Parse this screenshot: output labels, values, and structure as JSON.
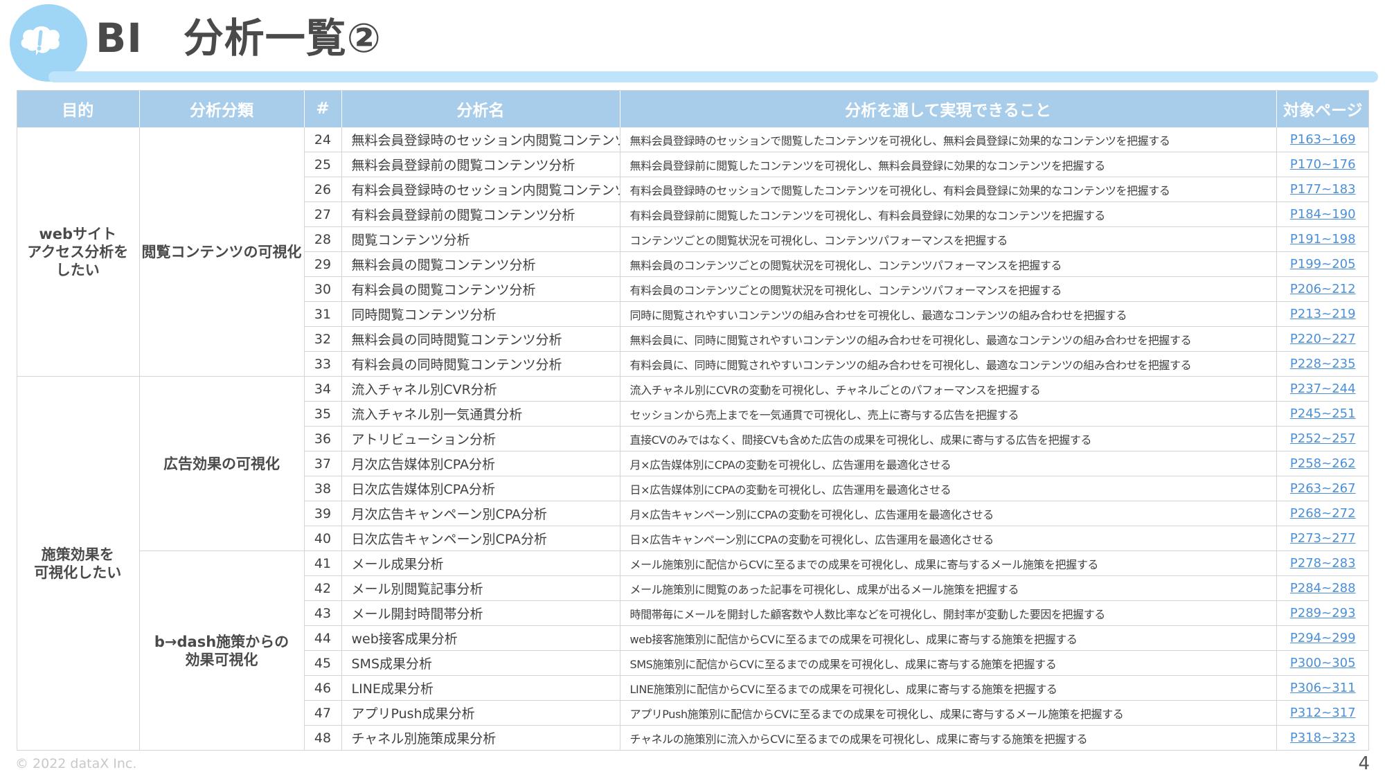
{
  "header": {
    "title": "BI　分析一覧②",
    "icon": "thought-bubble-exclamation-icon",
    "accent_color": "#9fd6f5"
  },
  "table": {
    "columns": [
      "目的",
      "分析分類",
      "#",
      "分析名",
      "分析を通して実現できること",
      "対象ページ"
    ],
    "groups": [
      {
        "purpose": "webサイト\nアクセス分析を\nしたい",
        "categories": [
          {
            "label": "閲覧コンテンツの可視化",
            "rows": [
              {
                "num": "24",
                "name": "無料会員登録時のセッション内閲覧コンテンツ分析",
                "desc": "無料会員登録時のセッションで閲覧したコンテンツを可視化し、無料会員登録に効果的なコンテンツを把握する",
                "page": "P163~169"
              },
              {
                "num": "25",
                "name": "無料会員登録前の閲覧コンテンツ分析",
                "desc": "無料会員登録前に閲覧したコンテンツを可視化し、無料会員登録に効果的なコンテンツを把握する",
                "page": "P170~176"
              },
              {
                "num": "26",
                "name": "有料会員登録時のセッション内閲覧コンテンツ分析",
                "desc": "有料会員登録時のセッションで閲覧したコンテンツを可視化し、有料会員登録に効果的なコンテンツを把握する",
                "page": "P177~183"
              },
              {
                "num": "27",
                "name": "有料会員登録前の閲覧コンテンツ分析",
                "desc": "有料会員登録前に閲覧したコンテンツを可視化し、有料会員登録に効果的なコンテンツを把握する",
                "page": "P184~190"
              },
              {
                "num": "28",
                "name": "閲覧コンテンツ分析",
                "desc": "コンテンツごとの閲覧状況を可視化し、コンテンツパフォーマンスを把握する",
                "page": "P191~198"
              },
              {
                "num": "29",
                "name": "無料会員の閲覧コンテンツ分析",
                "desc": "無料会員のコンテンツごとの閲覧状況を可視化し、コンテンツパフォーマンスを把握する",
                "page": "P199~205"
              },
              {
                "num": "30",
                "name": "有料会員の閲覧コンテンツ分析",
                "desc": "有料会員のコンテンツごとの閲覧状況を可視化し、コンテンツパフォーマンスを把握する",
                "page": "P206~212"
              },
              {
                "num": "31",
                "name": "同時閲覧コンテンツ分析",
                "desc": "同時に閲覧されやすいコンテンツの組み合わせを可視化し、最適なコンテンツの組み合わせを把握する",
                "page": "P213~219"
              },
              {
                "num": "32",
                "name": "無料会員の同時閲覧コンテンツ分析",
                "desc": "無料会員に、同時に閲覧されやすいコンテンツの組み合わせを可視化し、最適なコンテンツの組み合わせを把握する",
                "page": "P220~227"
              },
              {
                "num": "33",
                "name": "有料会員の同時閲覧コンテンツ分析",
                "desc": "有料会員に、同時に閲覧されやすいコンテンツの組み合わせを可視化し、最適なコンテンツの組み合わせを把握する",
                "page": "P228~235"
              }
            ]
          }
        ]
      },
      {
        "purpose": "施策効果を\n可視化したい",
        "categories": [
          {
            "label": "広告効果の可視化",
            "rows": [
              {
                "num": "34",
                "name": "流入チャネル別CVR分析",
                "desc": "流入チャネル別にCVRの変動を可視化し、チャネルごとのパフォーマンスを把握する",
                "page": "P237~244"
              },
              {
                "num": "35",
                "name": "流入チャネル別一気通貫分析",
                "desc": "セッションから売上までを一気通貫で可視化し、売上に寄与する広告を把握する",
                "page": "P245~251"
              },
              {
                "num": "36",
                "name": "アトリビューション分析",
                "desc": "直接CVのみではなく、間接CVも含めた広告の成果を可視化し、成果に寄与する広告を把握する",
                "page": "P252~257"
              },
              {
                "num": "37",
                "name": "月次広告媒体別CPA分析",
                "desc": "月×広告媒体別にCPAの変動を可視化し、広告運用を最適化させる",
                "page": "P258~262"
              },
              {
                "num": "38",
                "name": "日次広告媒体別CPA分析",
                "desc": "日×広告媒体別にCPAの変動を可視化し、広告運用を最適化させる",
                "page": "P263~267"
              },
              {
                "num": "39",
                "name": "月次広告キャンペーン別CPA分析",
                "desc": "月×広告キャンペーン別にCPAの変動を可視化し、広告運用を最適化させる",
                "page": "P268~272"
              },
              {
                "num": "40",
                "name": "日次広告キャンペーン別CPA分析",
                "desc": "日×広告キャンペーン別にCPAの変動を可視化し、広告運用を最適化させる",
                "page": "P273~277"
              }
            ]
          },
          {
            "label": "b→dash施策からの\n効果可視化",
            "rows": [
              {
                "num": "41",
                "name": "メール成果分析",
                "desc": "メール施策別に配信からCVに至るまでの成果を可視化し、成果に寄与するメール施策を把握する",
                "page": "P278~283"
              },
              {
                "num": "42",
                "name": "メール別閲覧記事分析",
                "desc": "メール施策別に閲覧のあった記事を可視化し、成果が出るメール施策を把握する",
                "page": "P284~288"
              },
              {
                "num": "43",
                "name": "メール開封時間帯分析",
                "desc": "時間帯毎にメールを開封した顧客数や人数比率などを可視化し、開封率が変動した要因を把握する",
                "page": "P289~293"
              },
              {
                "num": "44",
                "name": "web接客成果分析",
                "desc": "web接客施策別に配信からCVに至るまでの成果を可視化し、成果に寄与する施策を把握する",
                "page": "P294~299"
              },
              {
                "num": "45",
                "name": "SMS成果分析",
                "desc": "SMS施策別に配信からCVに至るまでの成果を可視化し、成果に寄与する施策を把握する",
                "page": "P300~305"
              },
              {
                "num": "46",
                "name": "LINE成果分析",
                "desc": "LINE施策別に配信からCVに至るまでの成果を可視化し、成果に寄与する施策を把握する",
                "page": "P306~311"
              },
              {
                "num": "47",
                "name": "アプリPush成果分析",
                "desc": "アプリPush施策別に配信からCVに至るまでの成果を可視化し、成果に寄与するメール施策を把握する",
                "page": "P312~317"
              },
              {
                "num": "48",
                "name": "チャネル別施策成果分析",
                "desc": "チャネルの施策別に流入からCVに至るまでの成果を可視化し、成果に寄与する施策を把握する",
                "page": "P318~323"
              }
            ]
          }
        ]
      }
    ]
  },
  "footer": {
    "copyright": "© 2022 dataX Inc.",
    "page_number": "4"
  },
  "colors": {
    "header_bg": "#a8cdeb",
    "link": "#4a90d9",
    "title_bar": "#bde4fa"
  }
}
